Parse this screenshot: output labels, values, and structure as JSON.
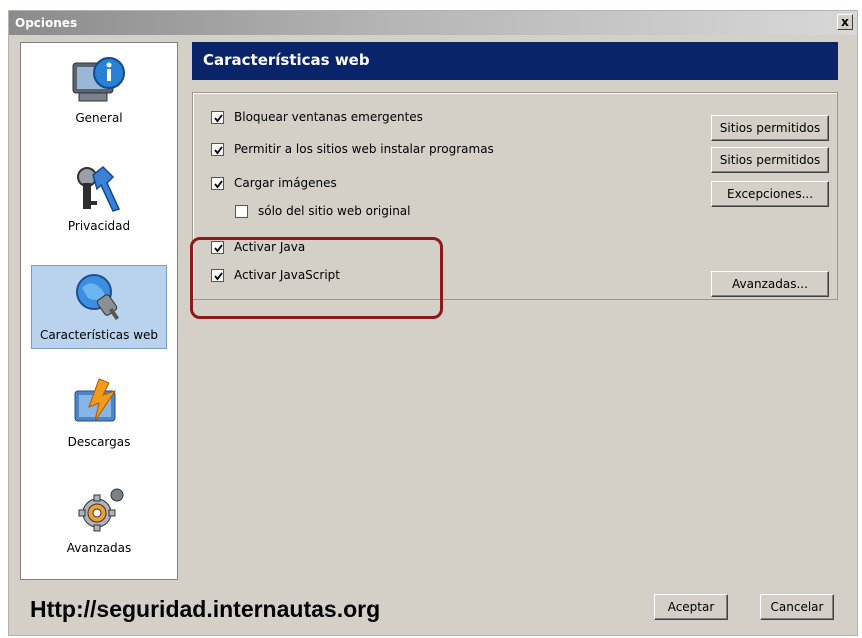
{
  "window": {
    "title": "Opciones",
    "close_glyph": "x"
  },
  "sidebar": {
    "items": [
      {
        "label": "General",
        "icon": "monitor-info-icon",
        "selected": false
      },
      {
        "label": "Privacidad",
        "icon": "keys-tools-icon",
        "selected": false
      },
      {
        "label": "Características web",
        "icon": "globe-plug-icon",
        "selected": true
      },
      {
        "label": "Descargas",
        "icon": "download-folder-icon",
        "selected": false
      },
      {
        "label": "Avanzadas",
        "icon": "gears-icon",
        "selected": false
      }
    ]
  },
  "panel": {
    "title": "Características web",
    "options": [
      {
        "label": "Bloquear ventanas emergentes",
        "checked": true
      },
      {
        "label": "Permitir a los sitios web instalar programas",
        "checked": true
      },
      {
        "label": "Cargar imágenes",
        "checked": true
      },
      {
        "label": "sólo del sitio web original",
        "checked": false
      },
      {
        "label": "Activar Java",
        "checked": true
      },
      {
        "label": "Activar JavaScript",
        "checked": true
      }
    ],
    "buttons": {
      "popup_allowed": "Sitios permitidos",
      "install_allowed": "Sitios permitidos",
      "exceptions": "Excepciones...",
      "advanced": "Avanzadas..."
    }
  },
  "footer": {
    "url": "Http://seguridad.internautas.org",
    "accept": "Aceptar",
    "cancel": "Cancelar"
  },
  "colors": {
    "header_bg": "#0a246a",
    "highlight": "#8b1a1a",
    "selected_bg": "#b9d3ee"
  }
}
